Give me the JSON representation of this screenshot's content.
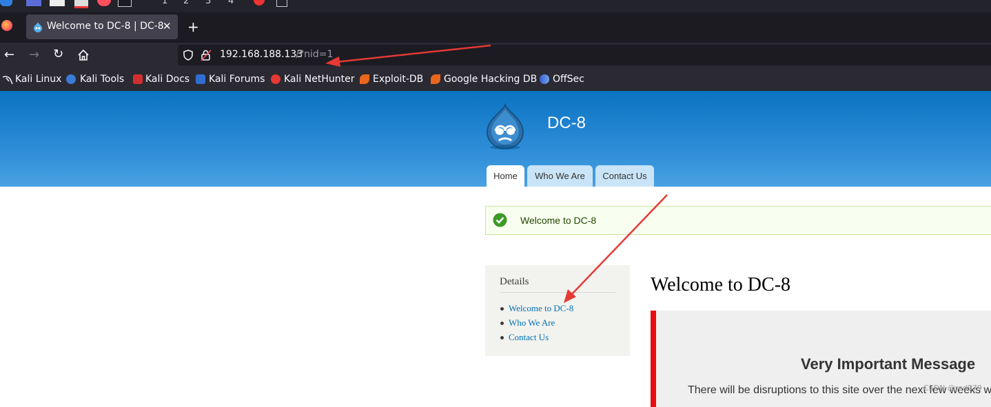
{
  "taskbar": {
    "workspaces": [
      "1",
      "2",
      "3",
      "4"
    ]
  },
  "browser": {
    "tab_title": "Welcome to DC-8 | DC-8",
    "new_tab_label": "+",
    "url_host": "192.168.188.133",
    "url_path": "/?nid=1"
  },
  "bookmarks": [
    {
      "label": "Kali Linux",
      "icon": "kali-dragon-icon"
    },
    {
      "label": "Kali Tools",
      "icon": "kali-tools-icon"
    },
    {
      "label": "Kali Docs",
      "icon": "kali-docs-icon"
    },
    {
      "label": "Kali Forums",
      "icon": "kali-forums-icon"
    },
    {
      "label": "Kali NetHunter",
      "icon": "nethunter-icon"
    },
    {
      "label": "Exploit-DB",
      "icon": "exploitdb-icon"
    },
    {
      "label": "Google Hacking DB",
      "icon": "ghdb-icon"
    },
    {
      "label": "OffSec",
      "icon": "offsec-icon"
    }
  ],
  "site": {
    "name": "DC-8",
    "nav": [
      "Home",
      "Who We Are",
      "Contact Us"
    ],
    "active_nav": "Home",
    "status_message": "Welcome to DC-8"
  },
  "sidebar": {
    "title": "Details",
    "links": [
      "Welcome to DC-8",
      "Who We Are",
      "Contact Us"
    ]
  },
  "main": {
    "title": "Welcome to DC-8",
    "block_heading": "Very Important Message",
    "paragraph": "There will be disruptions to this site over the next few weeks w"
  },
  "watermark": "CSDN @red979",
  "colors": {
    "header_top": "#0a73c1",
    "header_bottom": "#48a1e2",
    "link": "#0071b3",
    "quote_border": "#ea0d0d",
    "annotation_arrow": "#e53935"
  }
}
